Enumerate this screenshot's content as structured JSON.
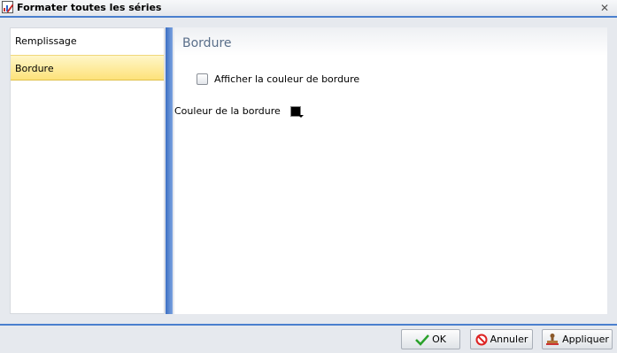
{
  "window": {
    "title": "Formater toutes les séries",
    "title_icon": "chart-format-icon",
    "close_icon": "close-icon"
  },
  "nav": {
    "items": [
      {
        "label": "Remplissage",
        "selected": false
      },
      {
        "label": "Bordure",
        "selected": true
      }
    ]
  },
  "content": {
    "section_title": "Bordure",
    "show_border_color": {
      "label": "Afficher la couleur de bordure",
      "checked": false
    },
    "border_color": {
      "label": "Couleur de la bordure",
      "value": "#000000",
      "icon": "color-picker-icon"
    }
  },
  "buttons": {
    "ok": {
      "label": "OK",
      "icon": "checkmark-icon"
    },
    "cancel": {
      "label": "Annuler",
      "icon": "cancel-icon"
    },
    "apply": {
      "label": "Appliquer",
      "icon": "stamp-icon"
    }
  },
  "colors": {
    "accent": "#4a7fce",
    "selected_item": "#fde27a",
    "section_title": "#5a6f8a"
  }
}
